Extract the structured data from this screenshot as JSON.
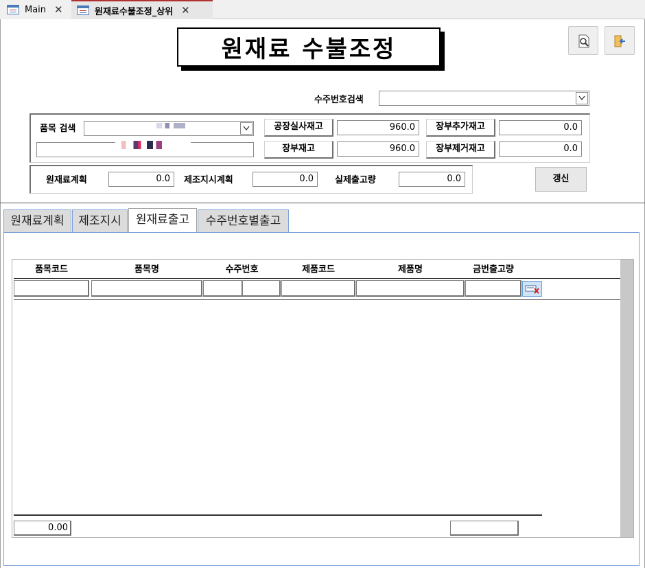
{
  "doc_tabs": [
    {
      "label": "Main",
      "close": "✕"
    },
    {
      "label": "원재료수불조정_상위",
      "close": "✕"
    }
  ],
  "title": "원재료 수불조정",
  "icons": {
    "preview": "print-preview-icon",
    "exit": "exit-door-icon"
  },
  "order_search": {
    "label": "수주번호검색",
    "value": ""
  },
  "item_search": {
    "label": "품목 검색",
    "value": "",
    "text_value": ""
  },
  "stock": {
    "factory_actual_label": "공장실사재고",
    "factory_actual_value": "960.0",
    "ledger_label": "장부재고",
    "ledger_value": "960.0",
    "ledger_add_label": "장부추가재고",
    "ledger_add_value": "0.0",
    "ledger_remove_label": "장부제거재고",
    "ledger_remove_value": "0.0"
  },
  "plans": {
    "material_plan_label": "원재료계획",
    "material_plan_value": "0.0",
    "production_order_label": "제조지시계획",
    "production_order_value": "0.0",
    "actual_issue_label": "실제출고량",
    "actual_issue_value": "0.0"
  },
  "refresh_label": "갱신",
  "tabs": [
    "원재료계획",
    "제조지시",
    "원재료출고",
    "수주번호별출고"
  ],
  "active_tab": 2,
  "grid": {
    "columns": [
      "품목코드",
      "품목명",
      "수주번호",
      "제품코드",
      "제품명",
      "금번출고량"
    ],
    "footer_total": "0.00",
    "footer_qty": ""
  },
  "colors": {
    "tab_border": "#7aa0d8",
    "active_doc_tab": "#b03030"
  }
}
